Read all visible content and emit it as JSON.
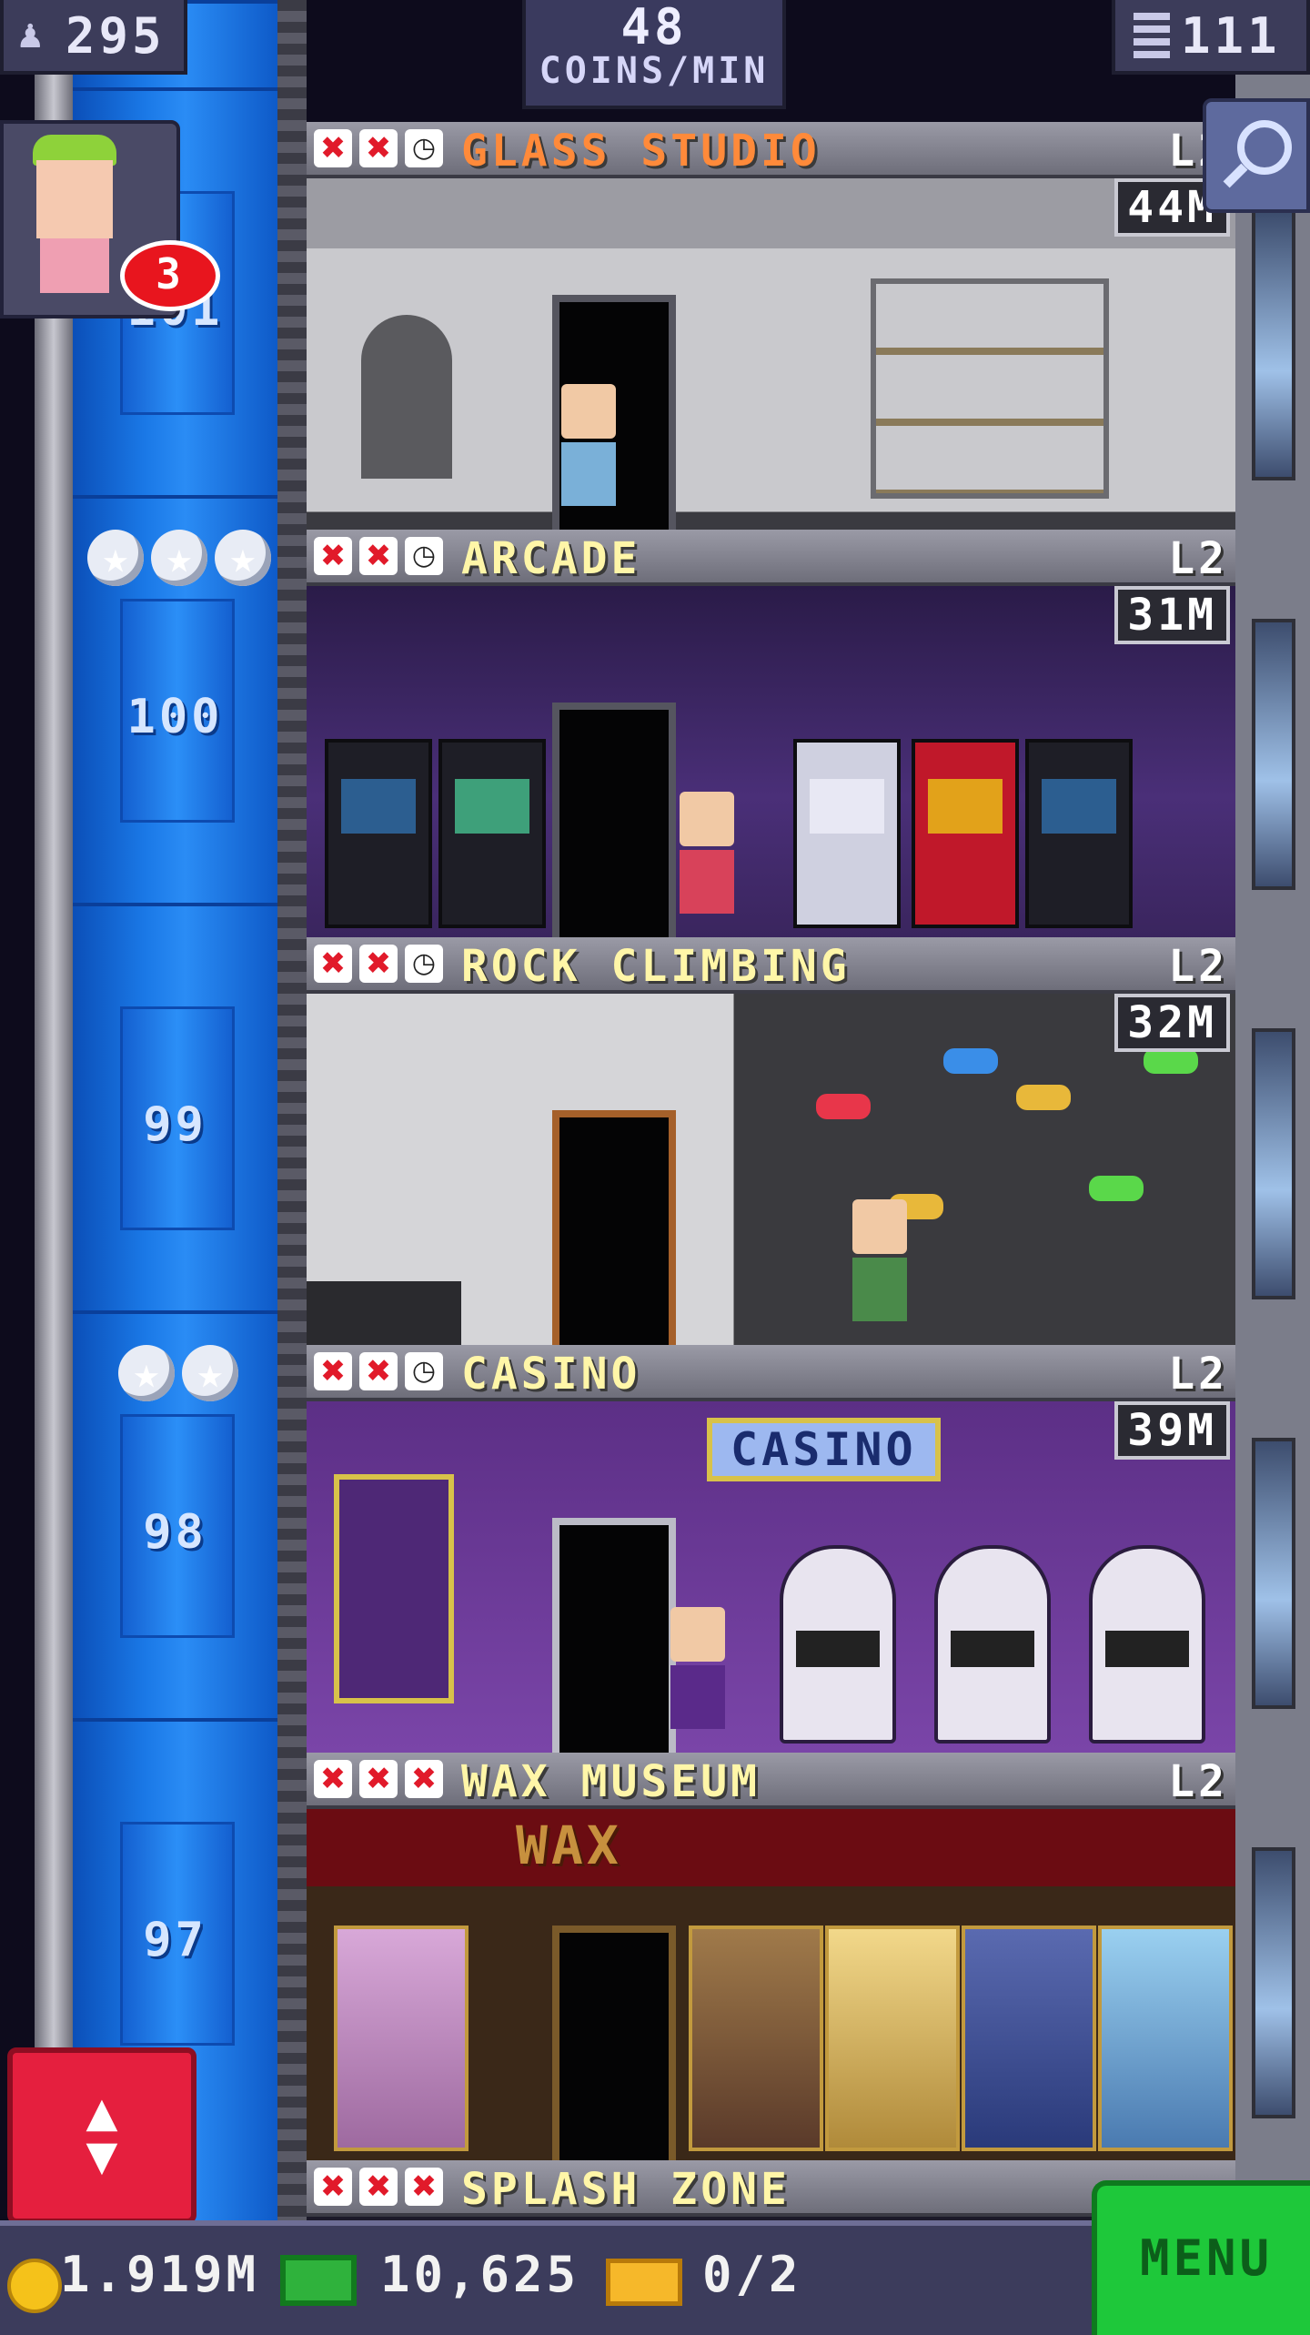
{
  "hud": {
    "population": "295",
    "rate_value": "48",
    "rate_unit": "COINS/MIN",
    "floors": "111",
    "visitor_badge": "3"
  },
  "shaft": {
    "floor_numbers": [
      "101",
      "100",
      "99",
      "98",
      "97"
    ]
  },
  "floors": [
    {
      "name": "GLASS STUDIO",
      "level": "L2",
      "timer": "44M",
      "marks": [
        "x",
        "x",
        "clock"
      ]
    },
    {
      "name": "ARCADE",
      "level": "L2",
      "timer": "31M",
      "marks": [
        "x",
        "x",
        "clock"
      ]
    },
    {
      "name": "ROCK CLIMBING",
      "level": "L2",
      "timer": "32M",
      "marks": [
        "x",
        "x",
        "clock"
      ]
    },
    {
      "name": "CASINO",
      "level": "L2",
      "timer": "39M",
      "marks": [
        "x",
        "x",
        "clock"
      ]
    },
    {
      "name": "WAX MUSEUM",
      "level": "L2",
      "timer": "",
      "marks": [
        "x",
        "x",
        "x"
      ]
    },
    {
      "name": "SPLASH ZONE",
      "level": "",
      "timer": "",
      "marks": [
        "x",
        "x",
        "x"
      ]
    }
  ],
  "signs": {
    "casino": "CASINO",
    "wax": "WAX"
  },
  "bottom": {
    "coins": "1.919M",
    "bux": "10,625",
    "tickets": "0/2",
    "menu_label": "MENU"
  },
  "colors": {
    "shaft_blue": "#1a78e6",
    "menu_green": "#1ec83a",
    "elevator_red": "#e51f3e",
    "badge_red": "#e8151e"
  }
}
